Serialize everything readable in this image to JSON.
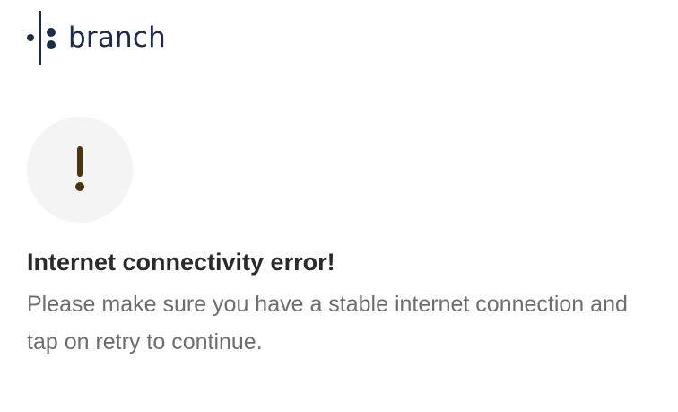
{
  "brand": {
    "name": "branch",
    "logo_icon": "branch-logo-mark"
  },
  "alert": {
    "icon": "exclamation-icon",
    "icon_color": "#4a3411",
    "circle_color": "#f4f4f4"
  },
  "error": {
    "title": "Internet connectivity error!",
    "message": "Please make sure you have a stable internet connection and tap on retry to continue."
  },
  "colors": {
    "brand": "#1c2b4a",
    "title": "#2a2a2a",
    "message": "#6e6e6e"
  }
}
